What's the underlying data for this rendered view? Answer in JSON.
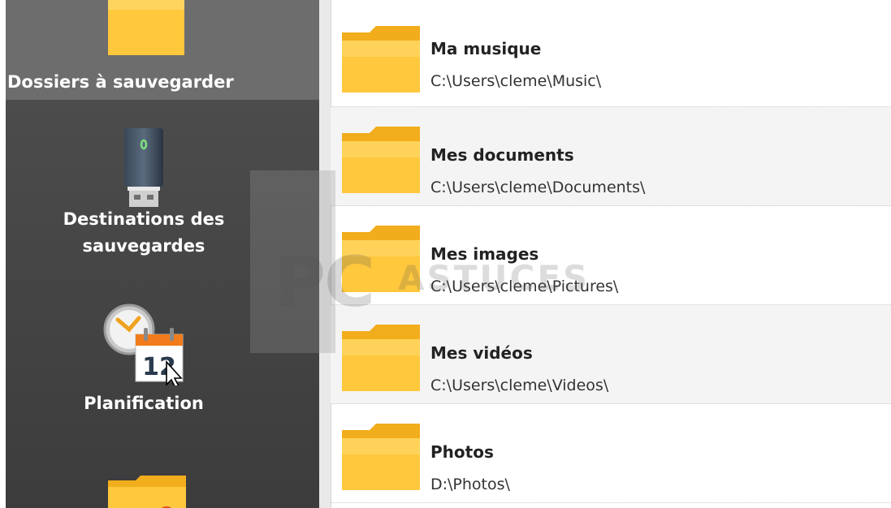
{
  "sidebar": {
    "items": [
      {
        "label": "Dossiers à sauvegarder",
        "icon": "folder-icon",
        "active": true
      },
      {
        "label": "Destinations des\nsauvegardes",
        "icon": "usb-drive-icon",
        "active": false
      },
      {
        "label": "Planification",
        "icon": "clock-calendar-icon",
        "calendar_day": "12",
        "active": false
      },
      {
        "label": "",
        "icon": "folder-alert-icon",
        "active": false
      }
    ]
  },
  "folders": [
    {
      "name": "Ma musique",
      "path": "C:\\Users\\cleme\\Music\\"
    },
    {
      "name": "Mes documents",
      "path": "C:\\Users\\cleme\\Documents\\"
    },
    {
      "name": "Mes images",
      "path": "C:\\Users\\cleme\\Pictures\\"
    },
    {
      "name": "Mes vidéos",
      "path": "C:\\Users\\cleme\\Videos\\"
    },
    {
      "name": "Photos",
      "path": "D:\\Photos\\"
    }
  ],
  "watermark": {
    "text_main": "PC",
    "text_sub": "ASTUCES"
  },
  "colors": {
    "sidebar_bg": "#454545",
    "sidebar_active": "#6d6d6d",
    "folder_yellow": "#ffc83d",
    "folder_yellow_dark": "#f2ad1c",
    "row_alt": "#f4f4f4"
  }
}
